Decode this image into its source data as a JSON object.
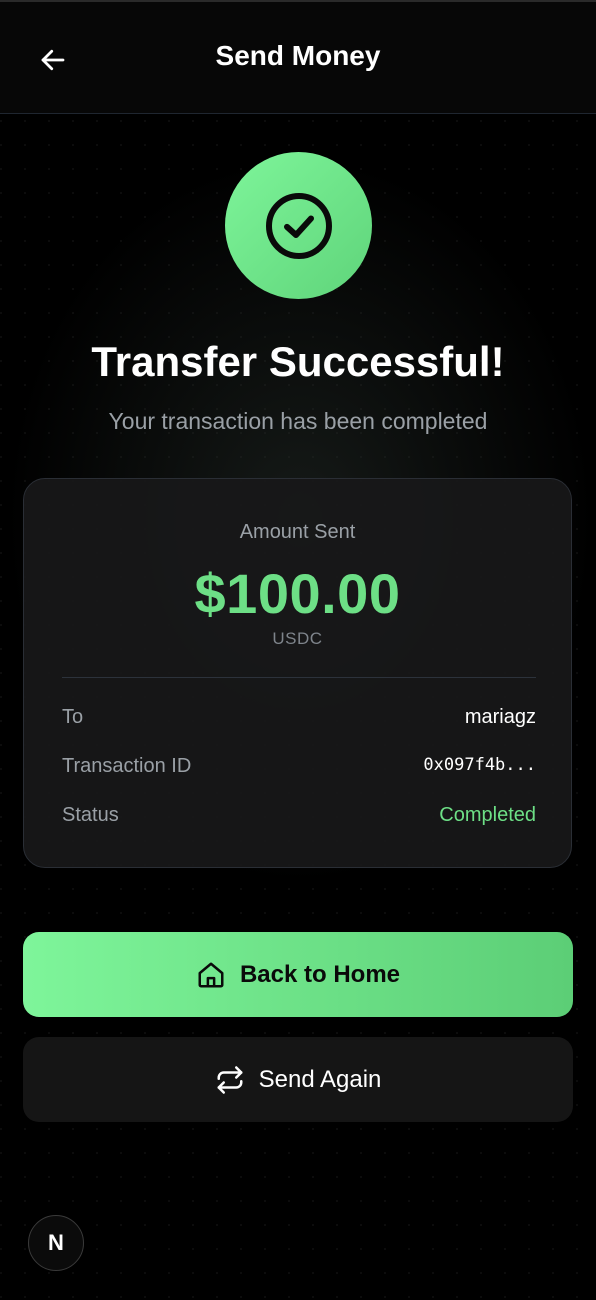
{
  "header": {
    "title": "Send Money",
    "back_icon": "arrow-left-icon"
  },
  "success": {
    "icon": "check-circle-icon",
    "title": "Transfer Successful!",
    "subtitle": "Your transaction has been completed"
  },
  "summary": {
    "amount_label": "Amount Sent",
    "amount": "$100.00",
    "currency": "USDC",
    "rows": [
      {
        "label": "To",
        "value": "mariagz"
      },
      {
        "label": "Transaction ID",
        "value": "0x097f4b..."
      },
      {
        "label": "Status",
        "value": "Completed"
      }
    ]
  },
  "actions": {
    "home_label": "Back to Home",
    "home_icon": "home-icon",
    "send_again_label": "Send Again",
    "send_again_icon": "repeat-icon"
  },
  "badge": {
    "letter": "N"
  },
  "colors": {
    "accent": "#6ddf86",
    "background": "#000000",
    "card": "#181819",
    "muted_text": "#9aa0a6"
  }
}
